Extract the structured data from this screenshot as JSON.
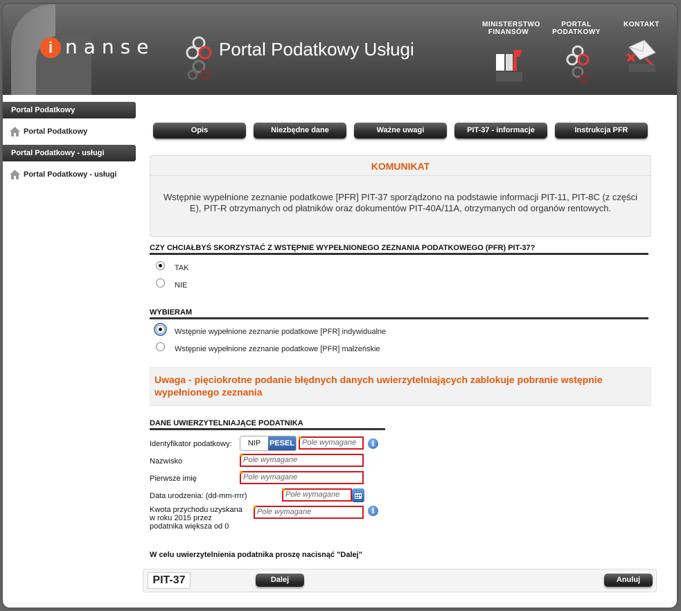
{
  "header": {
    "logo_letter": "i",
    "logo_text": "nanse",
    "portal_title": "Portal Podatkowy Usługi",
    "links": [
      {
        "label_line1": "MINISTERSTWO",
        "label_line2": "FINANSÓW",
        "icon": "mf-logo-icon"
      },
      {
        "label_line1": "PORTAL",
        "label_line2": "PODATKOWY",
        "icon": "portal-podatkowy-icon"
      },
      {
        "label_line1": "KONTAKT",
        "label_line2": "",
        "icon": "envelope-icon"
      }
    ]
  },
  "sidebar": {
    "sections": [
      {
        "title": "Portal Podatkowy",
        "item": "Portal Podatkowy"
      },
      {
        "title": "Portal Podatkowy - usługi",
        "item": "Portal Podatkowy - usługi"
      }
    ]
  },
  "nav_buttons": [
    "Opis",
    "Niezbędne dane",
    "Ważne uwagi",
    "PIT-37 - informacje",
    "Instrukcja PFR"
  ],
  "komunikat": {
    "title": "KOMUNIKAT",
    "text": "Wstępnie wypełnione zeznanie podatkowe [PFR] PIT-37 sporządzono na podstawie informacji PIT-11, PIT-8C (z części E), PIT-R otrzymanych od płatników oraz dokumentów PIT-40A/11A, otrzymanych od organów rentowych."
  },
  "question": {
    "title": "CZY CHCIAŁBYŚ SKORZYSTAĆ Z WSTĘPNIE WYPEŁNIONEGO ZEZNANIA PODATKOWEGO (PFR) PIT-37?",
    "options": [
      {
        "label": "TAK",
        "selected": true
      },
      {
        "label": "NIE",
        "selected": false
      }
    ]
  },
  "wybieram": {
    "title": "WYBIERAM",
    "options": [
      {
        "label": "Wstępnie wypełnione zeznanie podatkowe [PFR] indywidualne",
        "selected": true
      },
      {
        "label": "Wstępnie wypełnione zeznanie podatkowe [PFR] małżeńskie",
        "selected": false
      }
    ]
  },
  "warning": "Uwaga - pięciokrotne podanie błędnych danych uwierzytelniających zablokuje pobranie wstępnie wypełnionego zeznania",
  "auth": {
    "title": "DANE UWIERZYTELNIAJĄCE PODATNIKA",
    "id_label": "Identyfikator podatkowy:",
    "toggle": {
      "nip": "NIP",
      "pesel": "PESEL",
      "active": "PESEL"
    },
    "placeholder": "Pole wymagane",
    "surname_label": "Nazwisko",
    "firstname_label": "Pierwsze imię",
    "birthdate_label": "Data urodzenia: (dd-mm-rrrr)",
    "income_label_1": "Kwota przychodu uzyskana",
    "income_label_2": "w roku 2015 przez",
    "income_label_3": "podatnika większa od 0",
    "instruction": "W celu uwierzytelnienia podatnika proszę nacisnąć \"Dalej\""
  },
  "footer": {
    "form_name": "PIT-37",
    "next_label": "Dalej",
    "cancel_label": "Anuluj"
  },
  "colors": {
    "accent_orange": "#e05a10",
    "error_red": "#d4171c",
    "dark_button": "#2e2e2e",
    "pesel_blue": "#2d5aa1"
  }
}
